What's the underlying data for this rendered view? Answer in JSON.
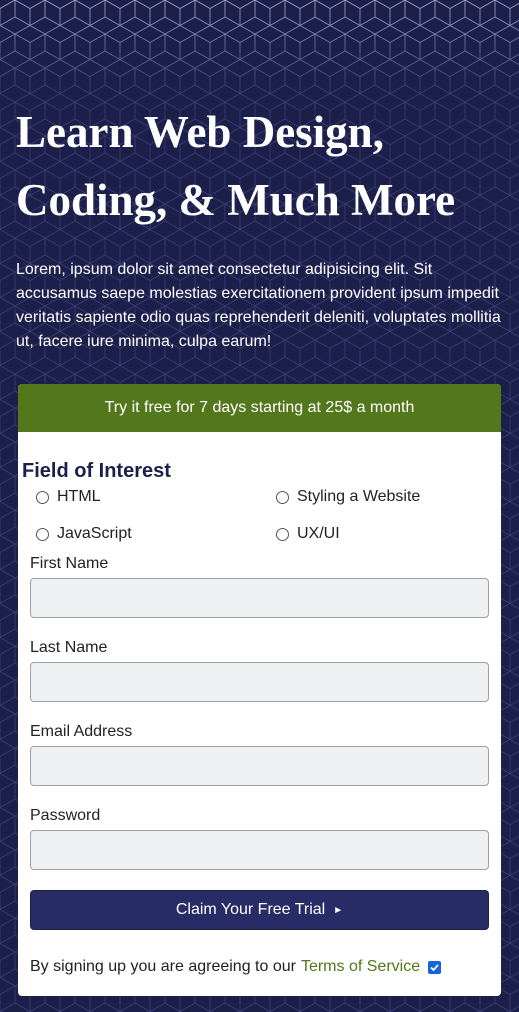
{
  "hero": {
    "title_line1": "Learn Web Design,",
    "title_line2": "Coding, & Much More",
    "description": "Lorem, ipsum dolor sit amet consectetur adipisicing elit. Sit accusamus saepe molestias exercitationem provident ipsum impedit veritatis sapiente odio quas reprehenderit deleniti, voluptates mollitia ut, facere iure minima, culpa earum!"
  },
  "form": {
    "banner": "Try it free for 7 days starting at 25$ a month",
    "interest_legend": "Field of Interest",
    "interests": [
      {
        "label": "HTML",
        "checked": false
      },
      {
        "label": "Styling a Website",
        "checked": false
      },
      {
        "label": "JavaScript",
        "checked": false
      },
      {
        "label": "UX/UI",
        "checked": false
      }
    ],
    "fields": {
      "first_name": {
        "label": "First Name",
        "value": ""
      },
      "last_name": {
        "label": "Last Name",
        "value": ""
      },
      "email": {
        "label": "Email Address",
        "value": ""
      },
      "password": {
        "label": "Password",
        "value": ""
      }
    },
    "submit_label": "Claim Your Free Trial",
    "submit_icon": "triangle-right-icon",
    "terms_text": "By signing up you are agreeing to our",
    "terms_link": "Terms of Service",
    "terms_checked": true
  },
  "colors": {
    "background": "#1b1f4a",
    "accent_green": "#53771b",
    "button_navy": "#282c66"
  }
}
